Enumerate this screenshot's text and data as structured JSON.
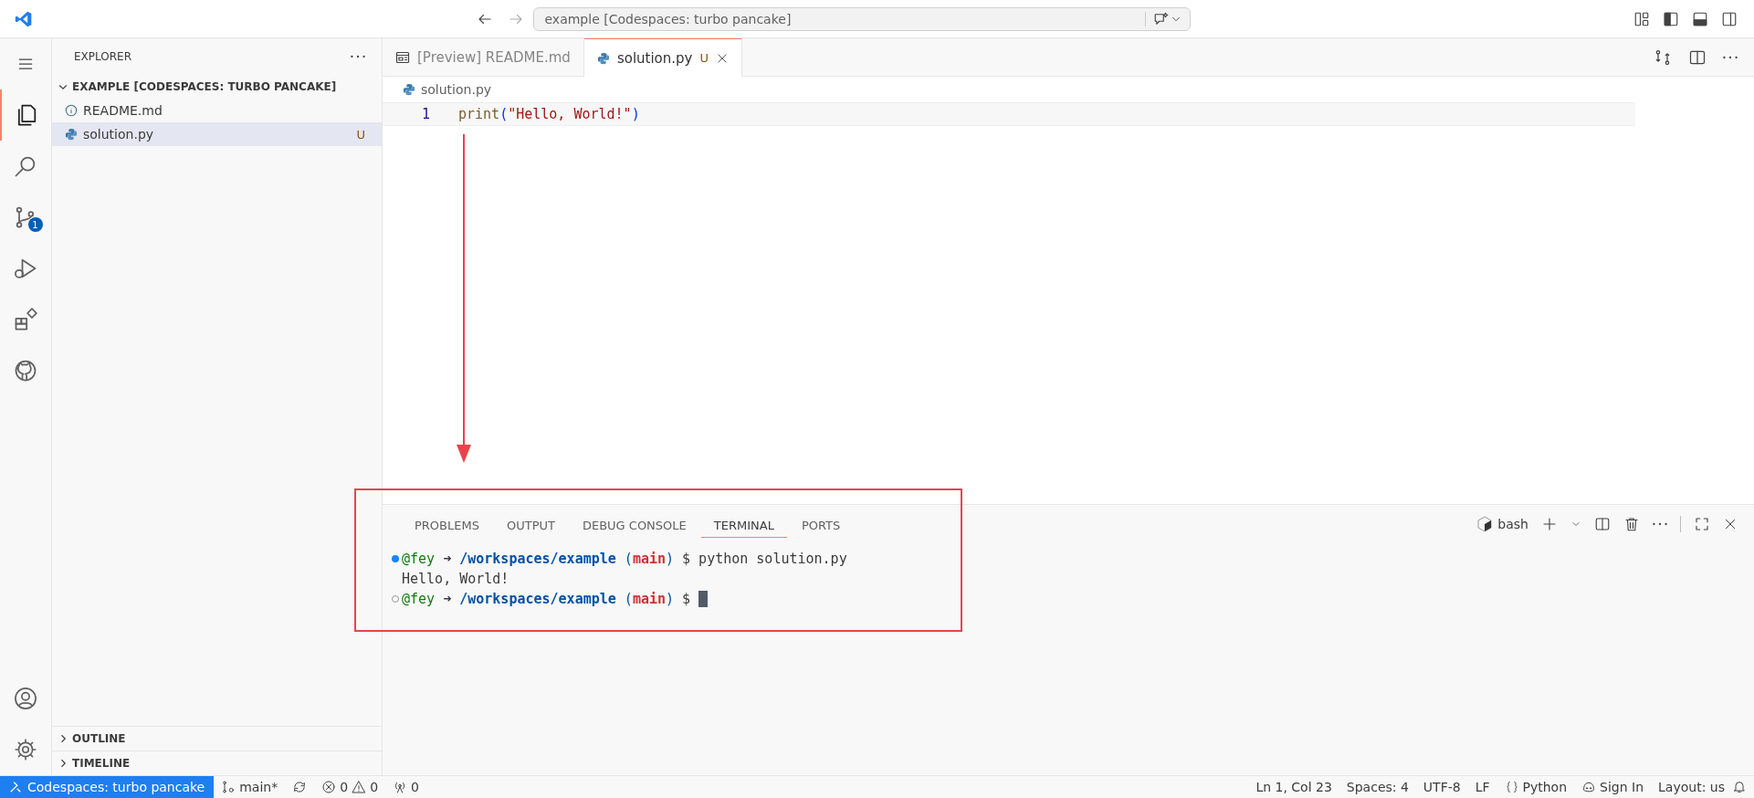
{
  "title_bar": {
    "search": "example [Codespaces: turbo pancake]"
  },
  "activity_bar": {
    "items": [
      {
        "kind": "explorer",
        "selected": true
      },
      {
        "kind": "search",
        "selected": false
      },
      {
        "kind": "source-control",
        "selected": false,
        "badge": "1"
      },
      {
        "kind": "run",
        "selected": false
      },
      {
        "kind": "extensions",
        "selected": false
      },
      {
        "kind": "github",
        "selected": false
      }
    ]
  },
  "explorer": {
    "title": "EXPLORER",
    "folder": {
      "name": "EXAMPLE [CODESPACES: TURBO PANCAKE]",
      "expanded": true,
      "children": [
        {
          "name": "README.md",
          "kind": "info",
          "selected": false
        },
        {
          "name": "solution.py",
          "kind": "python",
          "selected": true,
          "status": "U"
        }
      ]
    },
    "sections": [
      {
        "name": "OUTLINE",
        "expanded": false
      },
      {
        "name": "TIMELINE",
        "expanded": false
      }
    ]
  },
  "editor": {
    "tabs": [
      {
        "label": "[Preview] README.md",
        "kind": "preview",
        "selected": false
      },
      {
        "label": "solution.py",
        "kind": "python",
        "selected": true,
        "status": "U"
      }
    ],
    "breadcrumb": "solution.py",
    "lines": [
      {
        "number": "1",
        "tokens": [
          {
            "text": "print",
            "kind": "fn"
          },
          {
            "text": "(",
            "kind": "paren"
          },
          {
            "text": "\"Hello, World!\"",
            "kind": "string"
          },
          {
            "text": ")",
            "kind": "paren"
          }
        ]
      }
    ]
  },
  "panel": {
    "tabs": [
      {
        "label": "PROBLEMS",
        "selected": false
      },
      {
        "label": "OUTPUT",
        "selected": false
      },
      {
        "label": "DEBUG CONSOLE",
        "selected": false
      },
      {
        "label": "TERMINAL",
        "selected": true
      },
      {
        "label": "PORTS",
        "selected": false
      }
    ],
    "shell": "bash",
    "terminal": [
      {
        "kind": "success",
        "segments": [
          {
            "text": "@fey",
            "kind": "user"
          },
          {
            "text": " ➜ ",
            "kind": "plain"
          },
          {
            "text": "/workspaces/example",
            "kind": "path"
          },
          {
            "text": " (",
            "kind": "paren"
          },
          {
            "text": "main",
            "kind": "branch"
          },
          {
            "text": ")",
            "kind": "paren"
          },
          {
            "text": " $ python solution.py",
            "kind": "plain"
          }
        ]
      },
      {
        "kind": "output",
        "segments": [
          {
            "text": "Hello, World!",
            "kind": "plain"
          }
        ]
      },
      {
        "kind": "pending",
        "cursor": true,
        "segments": [
          {
            "text": "@fey",
            "kind": "user"
          },
          {
            "text": " ➜ ",
            "kind": "plain"
          },
          {
            "text": "/workspaces/example",
            "kind": "path"
          },
          {
            "text": " (",
            "kind": "paren"
          },
          {
            "text": "main",
            "kind": "branch"
          },
          {
            "text": ")",
            "kind": "paren"
          },
          {
            "text": " $ ",
            "kind": "plain"
          }
        ]
      }
    ]
  },
  "status_bar": {
    "remote": "Codespaces: turbo pancake",
    "branch": "main*",
    "errors": "0",
    "warnings": "0",
    "ports": "0",
    "right": [
      {
        "text": "Ln 1, Col 23",
        "kind": "text"
      },
      {
        "text": "Spaces: 4",
        "kind": "text"
      },
      {
        "text": "UTF-8",
        "kind": "text"
      },
      {
        "text": "LF",
        "kind": "text"
      },
      {
        "text": "Python",
        "kind": "language"
      },
      {
        "text": "Sign In",
        "kind": "account"
      },
      {
        "text": "Layout: us",
        "kind": "text"
      }
    ]
  }
}
